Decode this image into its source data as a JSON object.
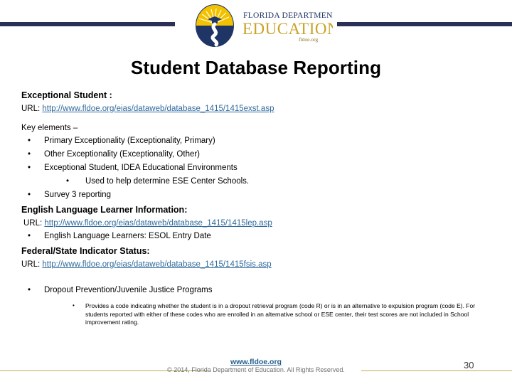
{
  "header": {
    "logo": {
      "name": "florida-department-of-education-logo",
      "line1": "FLORIDA DEPARTMENT OF",
      "line2": "EDUCATION",
      "line3": "fldoe.org"
    },
    "rule_color": "#2b3057"
  },
  "slide": {
    "title": "Student Database Reporting"
  },
  "sections": {
    "exceptional_student": {
      "heading": "Exceptional Student :",
      "url_label": "URL:",
      "url": "http://www.fldoe.org/eias/dataweb/database_1415/1415exst.asp",
      "key_elements_label": "Key elements –",
      "bullets": [
        "Primary Exceptionality (Exceptionality, Primary)",
        "Other Exceptionality  (Exceptionality, Other)",
        "Exceptional Student, IDEA Educational Environments"
      ],
      "sub_bullet": "Used to help determine ESE Center Schools.",
      "last_bullet": "Survey 3 reporting"
    },
    "english_language_learner": {
      "heading": "English Language Learner Information:",
      "url_label": "URL:",
      "url": "http://www.fldoe.org/eias/dataweb/database_1415/1415lep.asp",
      "bullet": "English Language Learners: ESOL Entry Date"
    },
    "federal_state_indicator": {
      "heading": "Federal/State Indicator Status:",
      "url_label": "URL:",
      "url": "http://www.fldoe.org/eias/dataweb/database_1415/1415fsis.asp",
      "bullet": "Dropout Prevention/Juvenile Justice Programs",
      "fine_print": "Provides a code indicating whether the student is in a dropout retrieval program (code R) or is in an alternative to expulsion program (code E). For students reported with either of these codes who are enrolled in an alternative school or ESE center, their test scores are not included in School improvement rating."
    }
  },
  "bullet_glyph": "•",
  "footer": {
    "url": "www.fldoe.org",
    "copyright": "© 2014, Florida Department of Education. All Rights Reserved.",
    "page_number": "30",
    "rule_color": "#bfa94b"
  },
  "colors": {
    "navy": "#2b3057",
    "link": "#2f6a9c",
    "footer_link": "#1f5c8b",
    "gold": "#bfa94b",
    "logo_gold": "#c9a227",
    "logo_navy": "#1f3566"
  }
}
